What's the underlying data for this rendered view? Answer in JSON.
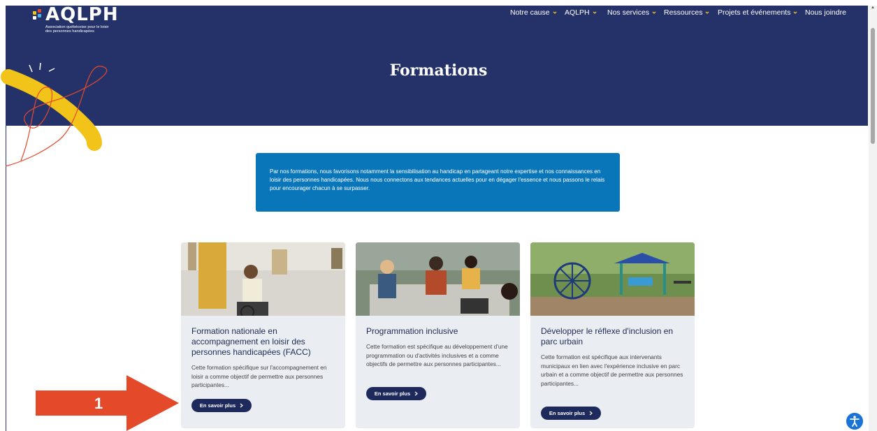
{
  "brand": {
    "name": "AQLPH",
    "tagline": "Association québécoise pour le loisir\ndes personnes handicapées"
  },
  "nav": [
    {
      "label": "Notre cause",
      "has_dropdown": true
    },
    {
      "label": "AQLPH",
      "has_dropdown": true
    },
    {
      "label": "Nos services",
      "has_dropdown": true
    },
    {
      "label": "Ressources",
      "has_dropdown": true
    },
    {
      "label": "Projets et événements",
      "has_dropdown": true
    },
    {
      "label": "Nous joindre",
      "has_dropdown": false
    }
  ],
  "page": {
    "title": "Formations"
  },
  "intro": "Par nos formations, nous favorisons notamment la sensibilisation au handicap en partageant notre expertise et nos connaissances en loisir des personnes handicapées. Nous nous connectons aux tendances actuelles pour en dégager l'essence et nous passons le relais pour encourager chacun à se surpasser.",
  "cards": [
    {
      "title": "Formation nationale en accompagnement en loisir des personnes handicapées (FACC)",
      "text": "Cette formation spécifique sur l'accompagnement en loisir a comme objectif de permettre aux personnes participantes...",
      "button": "En savoir plus"
    },
    {
      "title": "Programmation inclusive",
      "text": "Cette formation est spécifique au développement d'une programmation ou d'activités inclusives et a comme objectifs de permettre aux personnes participantes...",
      "button": "En savoir plus"
    },
    {
      "title": "Développer le réflexe d'inclusion en parc urbain",
      "text": "Cette formation est spécifique aux intervenants municipaux en lien avec l'expérience inclusive en parc urbain et a comme objectif de permettre aux personnes participantes...",
      "button": "En savoir plus"
    }
  ],
  "annotation": {
    "step": "1"
  },
  "colors": {
    "navy": "#243269",
    "intro_blue": "#0a76ba",
    "accent_yellow": "#f2c318",
    "card_bg": "#eaedf2",
    "arrow_red": "#e4492a"
  },
  "icons": {
    "dropdown": "chevron-down-icon",
    "button": "chevron-right-icon",
    "accessibility": "accessibility-icon"
  }
}
